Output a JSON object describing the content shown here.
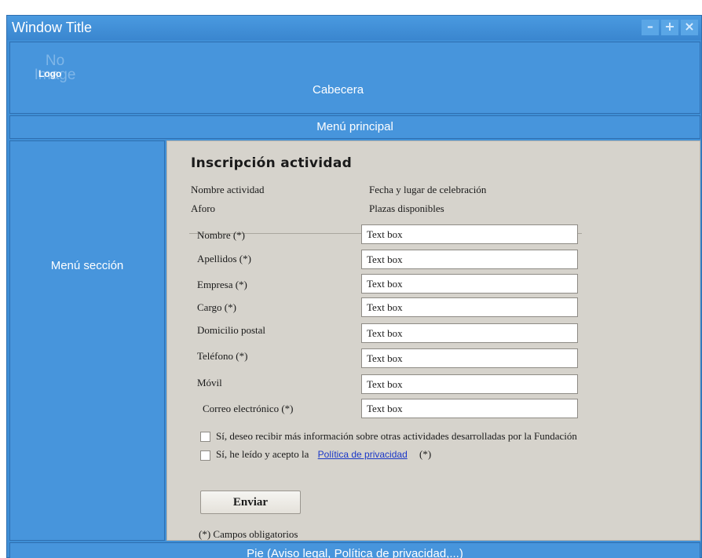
{
  "window": {
    "title": "Window Title",
    "controls": {
      "minimize": "–",
      "maximize": "+",
      "close": "×"
    }
  },
  "header": {
    "logo_placeholder": "No\nImage",
    "logo_label": "Logo",
    "title": "Cabecera"
  },
  "main_menu": {
    "label": "Menú principal"
  },
  "sidebar": {
    "label": "Menú sección"
  },
  "form": {
    "title": "Inscripción actividad",
    "info": {
      "activity_name": "Nombre actividad",
      "date_place": "Fecha y lugar de celebración",
      "capacity": "Aforo",
      "available": "Plazas disponibles"
    },
    "fields": [
      {
        "label": "Nombre (*)",
        "value": "Text box"
      },
      {
        "label": "Apellidos (*)",
        "value": "Text box"
      },
      {
        "label": "Empresa (*)",
        "value": "Text box"
      },
      {
        "label": "Cargo (*)",
        "value": "Text box"
      },
      {
        "label": "Domicilio postal",
        "value": "Text box"
      },
      {
        "label": "Teléfono (*)",
        "value": "Text box"
      },
      {
        "label": "Móvil",
        "value": "Text box"
      },
      {
        "label": "Correo electrónico (*)",
        "value": "Text box"
      }
    ],
    "checkbox_info": "Sí, deseo recibir más información sobre otras actividades desarrolladas por la Fundación",
    "checkbox_privacy_prefix": "Sí, he leído y acepto la",
    "privacy_link": "Política de privacidad",
    "privacy_suffix": "(*)",
    "submit": "Enviar",
    "footnote": "(*) Campos obligatorios"
  },
  "footer": {
    "label": "Pie (Aviso legal, Política de privacidad,...)"
  },
  "colors": {
    "frame_blue": "#4795dc",
    "content_bg": "#d6d3cc",
    "link": "#1a37c8"
  }
}
